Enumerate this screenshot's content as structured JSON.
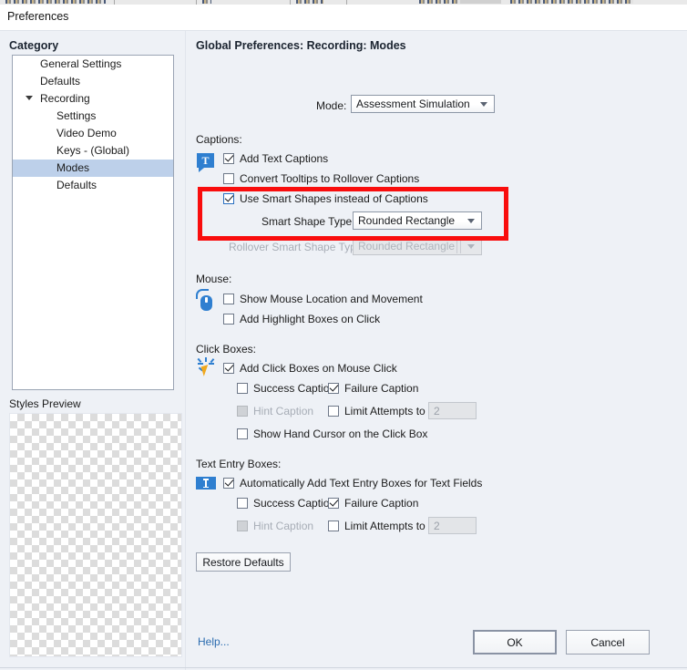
{
  "window": {
    "title": "Preferences"
  },
  "sidebar": {
    "heading": "Category",
    "items": [
      {
        "label": "General Settings",
        "level": 1,
        "selected": false,
        "expandable": false
      },
      {
        "label": "Defaults",
        "level": 1,
        "selected": false,
        "expandable": false
      },
      {
        "label": "Recording",
        "level": 1,
        "selected": false,
        "expandable": true
      },
      {
        "label": "Settings",
        "level": 2,
        "selected": false,
        "expandable": false
      },
      {
        "label": "Video Demo",
        "level": 2,
        "selected": false,
        "expandable": false
      },
      {
        "label": "Keys - (Global)",
        "level": 2,
        "selected": false,
        "expandable": false
      },
      {
        "label": "Modes",
        "level": 2,
        "selected": true,
        "expandable": false
      },
      {
        "label": "Defaults",
        "level": 2,
        "selected": false,
        "expandable": false
      }
    ],
    "styles_preview_label": "Styles Preview"
  },
  "content": {
    "heading": "Global Preferences: Recording: Modes",
    "mode": {
      "label": "Mode:",
      "value": "Assessment Simulation"
    },
    "captions": {
      "section_label": "Captions:",
      "icon": "text-caption-icon",
      "add_text_captions": {
        "label": "Add Text Captions",
        "checked": true,
        "disabled": false
      },
      "convert_tooltips": {
        "label": "Convert Tooltips to Rollover Captions",
        "checked": false,
        "disabled": false
      },
      "use_smart_shapes": {
        "label": "Use Smart Shapes instead of Captions",
        "checked": true,
        "disabled": false
      },
      "smart_shape_type": {
        "label": "Smart Shape Type",
        "value": "Rounded Rectangle",
        "disabled": false
      },
      "rollover_smart_shape_type": {
        "label": "Rollover Smart Shape Type",
        "value": "Rounded Rectangle",
        "disabled": true
      }
    },
    "mouse": {
      "section_label": "Mouse:",
      "icon": "mouse-icon",
      "show_location": {
        "label": "Show Mouse Location and Movement",
        "checked": false,
        "disabled": false
      },
      "add_highlight": {
        "label": "Add Highlight Boxes on Click",
        "checked": false,
        "disabled": false
      }
    },
    "click_boxes": {
      "section_label": "Click Boxes:",
      "icon": "click-cursor-icon",
      "add_click_boxes": {
        "label": "Add Click Boxes on Mouse Click",
        "checked": true,
        "disabled": false
      },
      "success_caption": {
        "label": "Success Caption",
        "checked": false,
        "disabled": false
      },
      "failure_caption": {
        "label": "Failure Caption",
        "checked": true,
        "disabled": false
      },
      "hint_caption": {
        "label": "Hint Caption",
        "checked": false,
        "disabled": true
      },
      "limit_attempts": {
        "label": "Limit Attempts to",
        "checked": false,
        "disabled": false,
        "value": "2"
      },
      "show_hand_cursor": {
        "label": "Show Hand Cursor on the Click Box",
        "checked": false,
        "disabled": false
      }
    },
    "text_entry_boxes": {
      "section_label": "Text Entry Boxes:",
      "icon": "text-entry-icon",
      "auto_add": {
        "label": "Automatically Add Text Entry Boxes for Text Fields",
        "checked": true,
        "disabled": false
      },
      "success_caption": {
        "label": "Success Caption",
        "checked": false,
        "disabled": false
      },
      "failure_caption": {
        "label": "Failure Caption",
        "checked": true,
        "disabled": false
      },
      "hint_caption": {
        "label": "Hint Caption",
        "checked": false,
        "disabled": true
      },
      "limit_attempts": {
        "label": "Limit Attempts to",
        "checked": false,
        "disabled": false,
        "value": "2"
      }
    },
    "restore_defaults_label": "Restore Defaults",
    "highlight": {
      "color": "#f90d0d",
      "target": "use-smart-shapes-group"
    }
  },
  "footer": {
    "help_label": "Help...",
    "ok_label": "OK",
    "cancel_label": "Cancel"
  }
}
